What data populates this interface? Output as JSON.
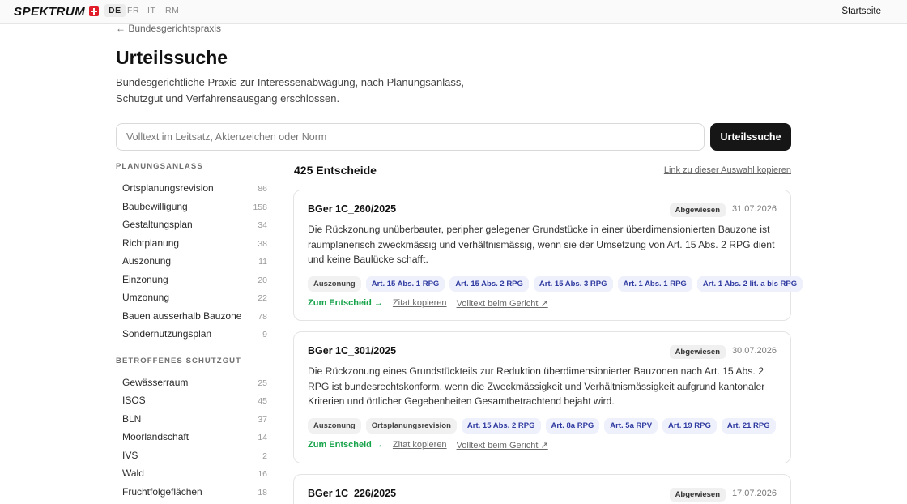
{
  "header": {
    "brand": "SPEKTRUM",
    "languages": [
      {
        "code": "DE",
        "active": true
      },
      {
        "code": "FR",
        "active": false
      },
      {
        "code": "IT",
        "active": false
      },
      {
        "code": "RM",
        "active": false
      }
    ],
    "home_link": "Startseite"
  },
  "back_link": "← Bundesgerichtspraxis",
  "page_title": "Urteilssuche",
  "subtitle": "Bundesgerichtliche Praxis zur Interessenabwägung, nach Planungsanlass, Schutzgut und Verfahrensausgang erschlossen.",
  "search": {
    "placeholder": "Volltext im Leitsatz, Aktenzeichen oder Norm",
    "value": "",
    "button_label": "Urteilssuche"
  },
  "facets": [
    {
      "heading": "PLANUNGSANLASS",
      "items": [
        {
          "label": "Ortsplanungsrevision",
          "count": "86"
        },
        {
          "label": "Baubewilligung",
          "count": "158"
        },
        {
          "label": "Gestaltungsplan",
          "count": "34"
        },
        {
          "label": "Richtplanung",
          "count": "38"
        },
        {
          "label": "Auszonung",
          "count": "11"
        },
        {
          "label": "Einzonung",
          "count": "20"
        },
        {
          "label": "Umzonung",
          "count": "22"
        },
        {
          "label": "Bauen ausserhalb Bauzone",
          "count": "78"
        },
        {
          "label": "Sondernutzungsplan",
          "count": "9"
        }
      ]
    },
    {
      "heading": "BETROFFENES SCHUTZGUT",
      "items": [
        {
          "label": "Gewässerraum",
          "count": "25"
        },
        {
          "label": "ISOS",
          "count": "45"
        },
        {
          "label": "BLN",
          "count": "37"
        },
        {
          "label": "Moorlandschaft",
          "count": "14"
        },
        {
          "label": "IVS",
          "count": "2"
        },
        {
          "label": "Wald",
          "count": "16"
        },
        {
          "label": "Fruchtfolgeflächen",
          "count": "18"
        }
      ]
    }
  ],
  "results": {
    "count_label": "425 Entscheide",
    "copy_selection_link": "Link zu dieser Auswahl kopieren",
    "cards": [
      {
        "case_number": "BGer 1C_260/2025",
        "outcome": "Abgewiesen",
        "date": "31.07.2026",
        "summary": "Die Rückzonung unüberbauter, peripher gelegener Grundstücke in einer überdimensionierten Bauzone ist raumplanerisch zweckmässig und verhältnismässig, wenn sie der Umsetzung von Art. 15 Abs. 2 RPG dient und keine Baulücke schafft.",
        "topic_tags": [
          "Auszonung"
        ],
        "norm_tags": [
          "Art. 15 Abs. 1 RPG",
          "Art. 15 Abs. 2 RPG",
          "Art. 15 Abs. 3 RPG",
          "Art. 1 Abs. 1 RPG",
          "Art. 1 Abs. 2 lit. a bis RPG"
        ]
      },
      {
        "case_number": "BGer 1C_301/2025",
        "outcome": "Abgewiesen",
        "date": "30.07.2026",
        "summary": "Die Rückzonung eines Grundstückteils zur Reduktion überdimensionierter Bauzonen nach Art. 15 Abs. 2 RPG ist bundesrechtskonform, wenn die Zweckmässigkeit und Verhältnismässigkeit aufgrund kantonaler Kriterien und örtlicher Gegebenheiten Gesamtbetrachtend bejaht wird.",
        "topic_tags": [
          "Auszonung",
          "Ortsplanungsrevision"
        ],
        "norm_tags": [
          "Art. 15 Abs. 2 RPG",
          "Art. 8a RPG",
          "Art. 5a RPV",
          "Art. 19 RPG",
          "Art. 21 RPG"
        ]
      },
      {
        "case_number": "BGer 1C_226/2025",
        "outcome": "Abgewiesen",
        "date": "17.07.2026",
        "summary": "",
        "topic_tags": [],
        "norm_tags": []
      }
    ],
    "actions": {
      "open": "Zum Entscheid →",
      "copy_citation": "Zitat kopieren",
      "full_text": "Volltext beim Gericht ↗"
    }
  },
  "colors": {
    "accent_green": "#16a34a",
    "norm_tag_text": "#2f3aa0",
    "norm_tag_bg": "#eef0fc",
    "button_dark": "#161616",
    "flag_red": "#e11d2a"
  }
}
